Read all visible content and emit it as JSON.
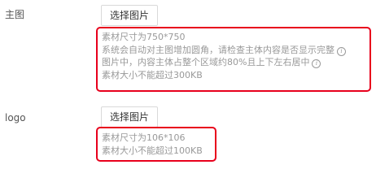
{
  "main_image": {
    "label": "主图",
    "button_label": "选择图片",
    "hints": [
      "素材尺寸为750*750",
      "系统会自动对主图增加圆角，请检查主体内容是否显示完整",
      "图片中，内容主体占整个区域约80%且上下左右居中",
      "素材大小不能超过300KB"
    ],
    "info_icon_glyph": "i"
  },
  "logo": {
    "label": "logo",
    "button_label": "选择图片",
    "hints": [
      "素材尺寸为106*106",
      "素材大小不能超过100KB"
    ]
  },
  "colors": {
    "highlight": "#e8001c",
    "hint_text": "#999999",
    "button_border": "#d9d9d9"
  }
}
